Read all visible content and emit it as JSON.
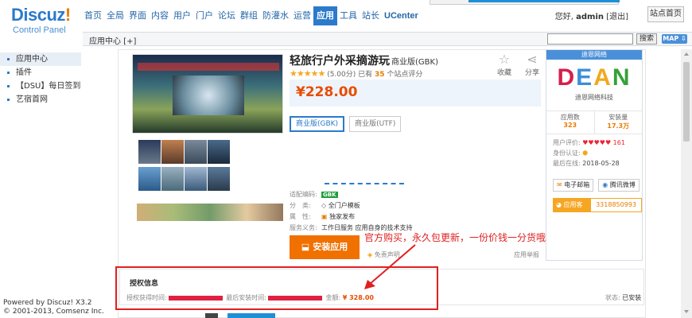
{
  "brand": {
    "logo": "Discuz",
    "logo_bang": "!",
    "subtitle": "Control Panel"
  },
  "nav": {
    "items": [
      "首页",
      "全局",
      "界面",
      "内容",
      "用户",
      "门户",
      "论坛",
      "群组",
      "防灌水",
      "运营",
      "应用",
      "工具",
      "站长",
      "UCenter"
    ],
    "active": "应用"
  },
  "user": {
    "greeting": "您好,",
    "name": "admin",
    "logout": "[退出]",
    "site_home": "站点首页"
  },
  "subbar": {
    "breadcrumb": "应用中心 [+]",
    "search_button": "搜索",
    "map_button": "MAP ⇩"
  },
  "sidebar": {
    "items": [
      "应用中心",
      "插件",
      "【DSU】每日签到",
      "艺宿首网"
    ],
    "active": "应用中心"
  },
  "footer": {
    "line1": "Powered by Discuz! X3.2",
    "line2": "© 2001-2013, Comsenz Inc."
  },
  "product": {
    "title": "轻旅行户外采摘游玩",
    "edition_tag": "商业版(GBK)",
    "rating_score": "(5.00分)",
    "rating_prefix": "已有",
    "rating_count": "35",
    "rating_suffix": "个站点评分",
    "favorite": "收藏",
    "share": "分享",
    "price": "¥228.00",
    "editions": [
      "商业版(GBK)",
      "商业版(UTF)"
    ],
    "meta": {
      "encoding_label": "适配编码:",
      "encoding": "GBK",
      "category_label": "分　类:",
      "category": "全门户模板",
      "property_label": "属　性:",
      "property": "独家发布",
      "service_label": "服务义务:",
      "service": "工作日服务  应用自身的技术支持"
    },
    "install_button": "安装应用",
    "disclaimer": "免责声明",
    "report": "应用举报",
    "annotation": "官方购买，永久包更新，一份价钱一分货哦"
  },
  "vendor": {
    "name": "迪恩网络",
    "logo_text": "DEAN",
    "logo_subtitle": "迪恩网络科技",
    "app_count_label": "应用数",
    "app_count": "323",
    "install_label": "安装量",
    "install_count": "17.3万",
    "rating_label": "用户评价:",
    "rating_hearts": "♥♥♥♥♥",
    "rating_value": "161",
    "auth_label": "身份认证:",
    "last_online_label": "最后在线:",
    "last_online": "2018-05-28",
    "email_button": "电子邮箱",
    "weibo_button": "腾讯微博",
    "qq_label": "应用客服",
    "qq_number": "3318850993"
  },
  "license": {
    "title": "授权信息",
    "obtained_label": "授权获得时间:",
    "last_install_label": "最后安装时间:",
    "amount_label": "金额:",
    "amount": "¥ 328.00",
    "status_label": "状态:",
    "status": "已安装"
  },
  "colors": {
    "accent": "#2b7acb",
    "price": "#e84c00",
    "install": "#f07000",
    "annotation": "#e02020"
  }
}
